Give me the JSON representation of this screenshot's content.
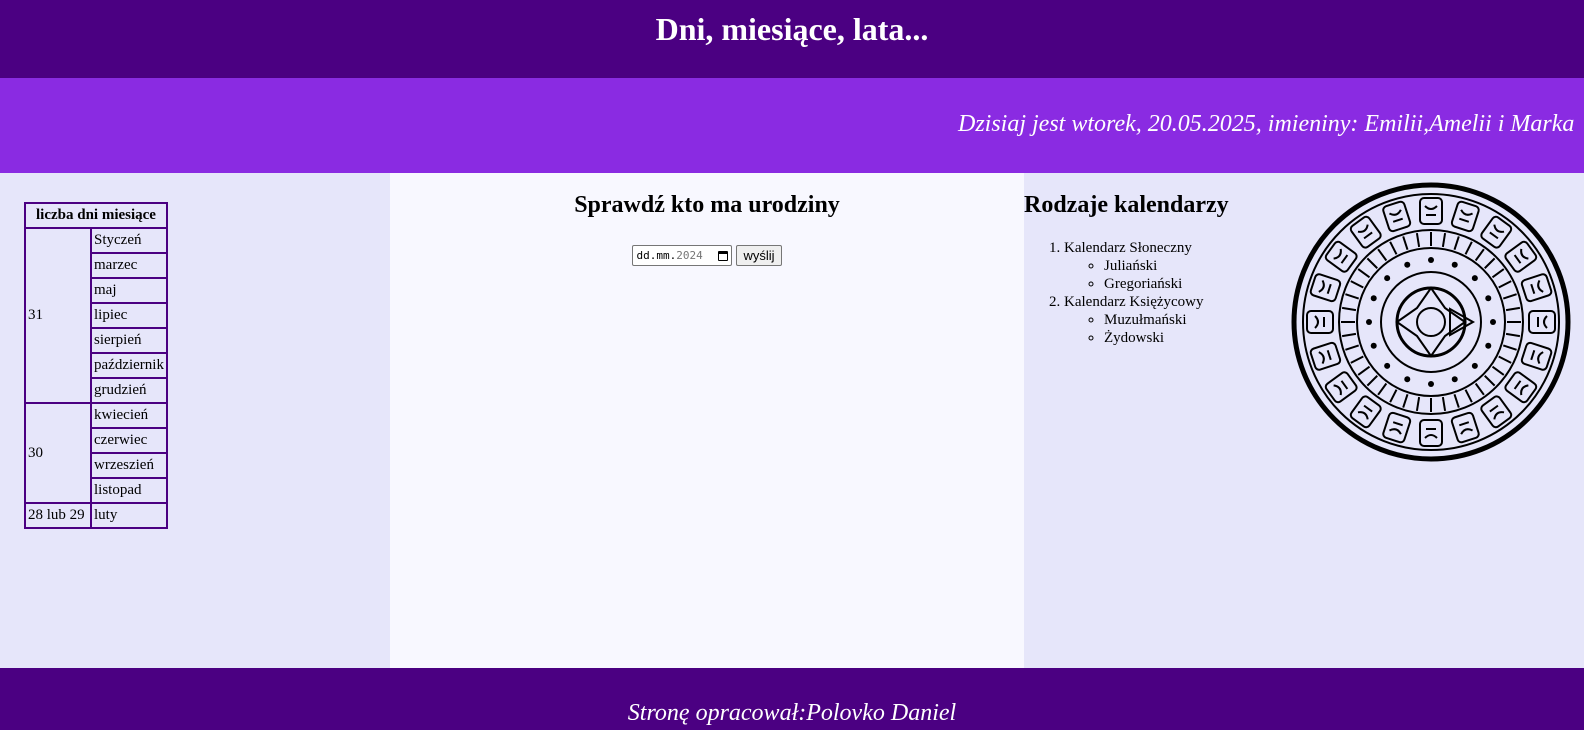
{
  "header": {
    "title": "Dni, miesiące, lata..."
  },
  "banner": {
    "text": "Dzisiaj jest wtorek, 20.05.2025, imieniny: Emilii,Amelii i Marka"
  },
  "months_table": {
    "header": "liczba dni miesiące",
    "groups": [
      {
        "days": "31",
        "months": [
          "Styczeń",
          "marzec",
          "maj",
          "lipiec",
          "sierpień",
          "październik",
          "grudzień"
        ]
      },
      {
        "days": "30",
        "months": [
          "kwiecień",
          "czerwiec",
          "wrzeszień",
          "listopad"
        ]
      },
      {
        "days": "28 lub 29",
        "months": [
          "luty"
        ]
      }
    ]
  },
  "birthday": {
    "title": "Sprawdź kto ma urodziny",
    "date_placeholder_day_month": "dd.mm.",
    "date_placeholder_year": "2024",
    "submit_label": "wyślij"
  },
  "calendars": {
    "title": "Rodzaje kalendarzy",
    "items": [
      {
        "label": "Kalendarz Słoneczny",
        "sub": [
          "Juliański",
          "Gregoriański"
        ]
      },
      {
        "label": "Kalendarz Księżycowy",
        "sub": [
          "Muzułmański",
          "Żydowski"
        ]
      }
    ]
  },
  "icons": {
    "calendar_image": "aztec-calendar-stone",
    "date_picker": "calendar-icon"
  },
  "colors": {
    "header_bg": "#4b0082",
    "banner_bg": "#8a2be2",
    "side_bg": "#e6e6fa",
    "center_bg": "#f8f8ff"
  },
  "footer": {
    "text": "Stronę opracował:Polovko Daniel"
  }
}
